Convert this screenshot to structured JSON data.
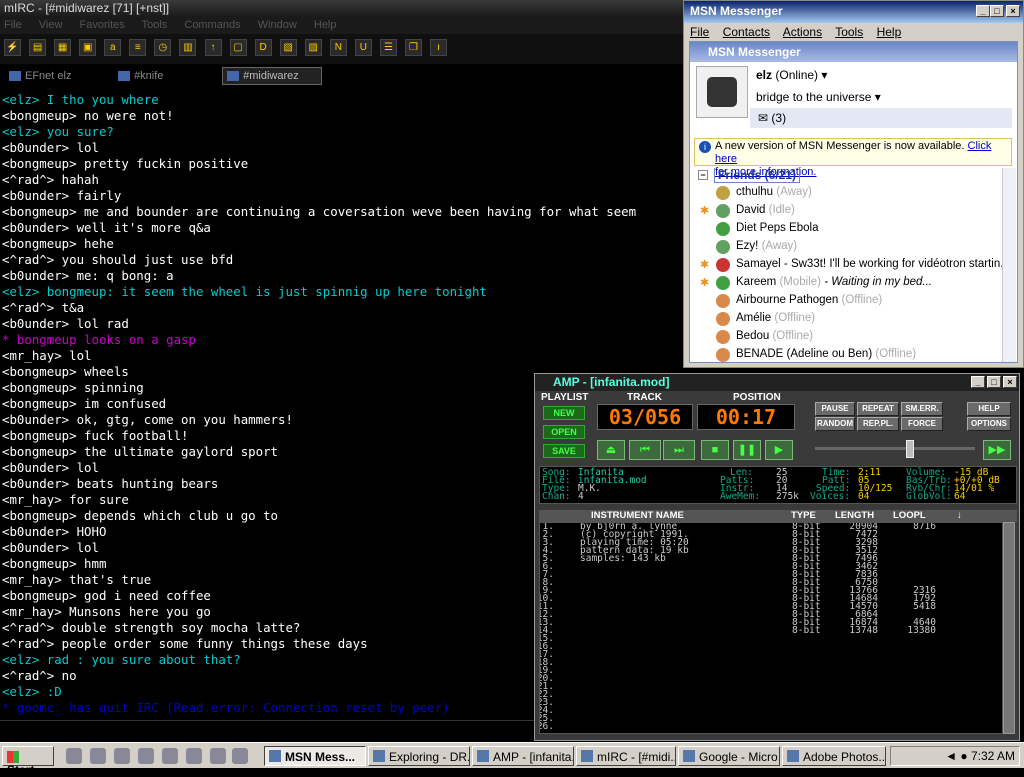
{
  "mirc": {
    "title": "mIRC - [#midiwarez [71] [+nst]]",
    "menu": [
      "File",
      "View",
      "Favorites",
      "Tools",
      "Commands",
      "Window",
      "Help"
    ],
    "tabs": [
      {
        "label": "EFnet elz",
        "active": false
      },
      {
        "label": "#knife",
        "active": false
      },
      {
        "label": "#midiwarez",
        "active": true
      }
    ],
    "colors": {
      "nick_self": "#00cccc",
      "action": "#cc00cc",
      "quit": "#0000cc",
      "default": "#ffffff"
    },
    "lines": [
      {
        "text": "<elz> I tho you where",
        "kind": "self"
      },
      {
        "text": "<bongmeup> no were not!",
        "kind": "normal"
      },
      {
        "text": "<elz> you sure?",
        "kind": "self"
      },
      {
        "text": "<b0under> lol",
        "kind": "normal"
      },
      {
        "text": "<bongmeup> pretty fuckin positive",
        "kind": "normal"
      },
      {
        "text": "<^rad^> hahah",
        "kind": "normal"
      },
      {
        "text": "<b0under> fairly",
        "kind": "normal"
      },
      {
        "text": "<bongmeup> me and bounder are continuing a coversation weve been having for what seem",
        "kind": "normal"
      },
      {
        "text": "<b0under> well it's more q&a",
        "kind": "normal"
      },
      {
        "text": "<bongmeup> hehe",
        "kind": "normal"
      },
      {
        "text": "<^rad^> you should just use bfd",
        "kind": "normal"
      },
      {
        "text": "<b0under> me: q bong: a",
        "kind": "normal"
      },
      {
        "text": "<elz> bongmeup: it seem the wheel is just spinnig up here tonight",
        "kind": "self"
      },
      {
        "text": "<^rad^> t&a",
        "kind": "normal"
      },
      {
        "text": "<b0under> lol rad",
        "kind": "normal"
      },
      {
        "text": "* bongmeup looks on a gasp",
        "kind": "action"
      },
      {
        "text": "<mr_hay> lol",
        "kind": "normal"
      },
      {
        "text": "<bongmeup> wheels",
        "kind": "normal"
      },
      {
        "text": "<bongmeup> spinning",
        "kind": "normal"
      },
      {
        "text": "<bongmeup> im confused",
        "kind": "normal"
      },
      {
        "text": "<b0under> ok, gtg, come on you hammers!",
        "kind": "normal"
      },
      {
        "text": "<bongmeup> fuck football!",
        "kind": "normal"
      },
      {
        "text": "<bongmeup> the ultimate gaylord sport",
        "kind": "normal"
      },
      {
        "text": "<b0under> lol",
        "kind": "normal"
      },
      {
        "text": "<b0under> beats hunting bears",
        "kind": "normal"
      },
      {
        "text": "<mr_hay> for sure",
        "kind": "normal"
      },
      {
        "text": "<bongmeup> depends which club u go to",
        "kind": "normal"
      },
      {
        "text": "<b0under> HOHO",
        "kind": "normal"
      },
      {
        "text": "<b0under> lol",
        "kind": "normal"
      },
      {
        "text": "<bongmeup> hmm",
        "kind": "normal"
      },
      {
        "text": "<mr_hay> that's true",
        "kind": "normal"
      },
      {
        "text": "<bongmeup> god i need coffee",
        "kind": "normal"
      },
      {
        "text": "<mr_hay> Munsons here you go",
        "kind": "normal"
      },
      {
        "text": "<^rad^> double strength soy mocha latte?",
        "kind": "normal"
      },
      {
        "text": "<^rad^> people order some funny things these days",
        "kind": "normal"
      },
      {
        "text": "<elz> rad : you sure about that?",
        "kind": "self"
      },
      {
        "text": "<^rad^> no",
        "kind": "normal"
      },
      {
        "text": "<elz> :D",
        "kind": "self"
      },
      {
        "text": "* goomc_ has quit IRC (Read error: Connection reset by peer)",
        "kind": "quit"
      }
    ]
  },
  "msn": {
    "title": "MSN Messenger",
    "menu": [
      "File",
      "Contacts",
      "Actions",
      "Tools",
      "Help"
    ],
    "panel_title": "MSN Messenger",
    "user": "elz",
    "user_status": "(Online)",
    "tagline": "bridge to the universe",
    "mail_count": "(3)",
    "notice_text": "A new version of MSN Messenger is now available.",
    "notice_link1": "Click here",
    "notice_link2": "for more information.",
    "friends_header": "Friends (6/21)",
    "friends": [
      {
        "name": "cthulhu",
        "status": "(Away)",
        "msg": "",
        "star": false,
        "color": "#c0a040"
      },
      {
        "name": "David",
        "status": "(Idle)",
        "msg": "",
        "star": true,
        "color": "#60a060"
      },
      {
        "name": "Diet Peps Ebola",
        "status": "",
        "msg": "",
        "star": false,
        "color": "#40a040"
      },
      {
        "name": "Ezy!",
        "status": "(Away)",
        "msg": "",
        "star": false,
        "color": "#60a060"
      },
      {
        "name": "Samayel - Sw33t! I'll be working for vidéotron startin...",
        "status": "",
        "msg": "",
        "star": true,
        "color": "#cc3333"
      },
      {
        "name": "Kareem",
        "status": "(Mobile)",
        "msg": "- Waiting in my bed...",
        "star": true,
        "color": "#40a040"
      },
      {
        "name": "Airbourne Pathogen",
        "status": "(Offline)",
        "msg": "",
        "star": false,
        "color": "#d98a4a"
      },
      {
        "name": "Amélie",
        "status": "(Offline)",
        "msg": "",
        "star": false,
        "color": "#d98a4a"
      },
      {
        "name": "Bedou",
        "status": "(Offline)",
        "msg": "",
        "star": false,
        "color": "#d98a4a"
      },
      {
        "name": "BENADE (Adeline ou Ben)",
        "status": "(Offline)",
        "msg": "",
        "star": false,
        "color": "#d98a4a"
      }
    ]
  },
  "amp": {
    "title": "AMP - [infanita.mod]",
    "labels": {
      "playlist": "PLAYLIST",
      "track": "TRACK",
      "position": "POSITION"
    },
    "playlist_buttons": [
      "NEW",
      "OPEN",
      "SAVE"
    ],
    "track_display": "03/056",
    "position_display": "00:17",
    "mode_buttons": [
      "PAUSE",
      "REPEAT",
      "SM.ERR.",
      "RANDOM",
      "REP.PL.",
      "FORCE"
    ],
    "side_buttons": [
      "HELP",
      "OPTIONS"
    ],
    "transport_icons": [
      "eject-icon",
      "prev-icon",
      "next-icon",
      "stop-icon",
      "pause-icon",
      "play-icon"
    ],
    "volume_level": 0.6,
    "info": {
      "song_label": "Song:",
      "song": "Infanita",
      "file_label": "File:",
      "file": "infanita.mod",
      "type_label": "Type:",
      "type": "M.K.",
      "chan_label": "Chan:",
      "chan": "4",
      "len_label": "Len:",
      "len": "25",
      "patts_label": "Patts:",
      "patts": "20",
      "instr_label": "Instr:",
      "instr": "14",
      "awemem_label": "AweMem:",
      "awemem": "275k",
      "time_label": "Time:",
      "time": "2:11",
      "patt_label": "Patt:",
      "patt": "05",
      "speed_label": "Speed:",
      "speed": "10/125",
      "voices_label": "Voices:",
      "voices": "04",
      "volume_label": "Volume:",
      "volume": "-15 dB",
      "bastrb_label": "Bas/Trb:",
      "bastrb": "+0/+0 dB",
      "rvbchr_label": "Rvb/Chr:",
      "rvbchr": "14/01 %",
      "globvol_label": "GlobVol:",
      "globvol": "64"
    },
    "inst_headers": [
      "INSTRUMENT NAME",
      "TYPE",
      "LENGTH",
      "LOOPL",
      "↓"
    ],
    "instruments": [
      {
        "n": "1.",
        "name": "by bj0rn a. lynne",
        "type": "8-bit",
        "length": "20904",
        "loopl": "8716"
      },
      {
        "n": "2.",
        "name": "(c) copyright 1991.",
        "type": "8-bit",
        "length": "7472",
        "loopl": ""
      },
      {
        "n": "3.",
        "name": "playing time: 05:20",
        "type": "8-bit",
        "length": "3298",
        "loopl": ""
      },
      {
        "n": "4.",
        "name": "pattern data: 19 kb",
        "type": "8-bit",
        "length": "3512",
        "loopl": ""
      },
      {
        "n": "5.",
        "name": "samples: 143 kb",
        "type": "8-bit",
        "length": "7496",
        "loopl": ""
      },
      {
        "n": "6.",
        "name": "",
        "type": "8-bit",
        "length": "3462",
        "loopl": ""
      },
      {
        "n": "7.",
        "name": "",
        "type": "8-bit",
        "length": "7836",
        "loopl": ""
      },
      {
        "n": "8.",
        "name": "",
        "type": "8-bit",
        "length": "6750",
        "loopl": ""
      },
      {
        "n": "9.",
        "name": "",
        "type": "8-bit",
        "length": "13766",
        "loopl": "2316"
      },
      {
        "n": "10.",
        "name": "",
        "type": "8-bit",
        "length": "14684",
        "loopl": "1792"
      },
      {
        "n": "11.",
        "name": "",
        "type": "8-bit",
        "length": "14570",
        "loopl": "5418"
      },
      {
        "n": "12.",
        "name": "",
        "type": "8-bit",
        "length": "6864",
        "loopl": ""
      },
      {
        "n": "13.",
        "name": "",
        "type": "8-bit",
        "length": "16874",
        "loopl": "4640"
      },
      {
        "n": "14.",
        "name": "",
        "type": "8-bit",
        "length": "13748",
        "loopl": "13380"
      },
      {
        "n": "15.",
        "name": "",
        "type": "",
        "length": "",
        "loopl": ""
      },
      {
        "n": "16.",
        "name": "",
        "type": "",
        "length": "",
        "loopl": ""
      },
      {
        "n": "17.",
        "name": "",
        "type": "",
        "length": "",
        "loopl": ""
      },
      {
        "n": "18.",
        "name": "",
        "type": "",
        "length": "",
        "loopl": ""
      },
      {
        "n": "19.",
        "name": "",
        "type": "",
        "length": "",
        "loopl": ""
      },
      {
        "n": "20.",
        "name": "",
        "type": "",
        "length": "",
        "loopl": ""
      },
      {
        "n": "21.",
        "name": "",
        "type": "",
        "length": "",
        "loopl": ""
      },
      {
        "n": "22.",
        "name": "",
        "type": "",
        "length": "",
        "loopl": ""
      },
      {
        "n": "23.",
        "name": "",
        "type": "",
        "length": "",
        "loopl": ""
      },
      {
        "n": "24.",
        "name": "",
        "type": "",
        "length": "",
        "loopl": ""
      },
      {
        "n": "25.",
        "name": "",
        "type": "",
        "length": "",
        "loopl": ""
      },
      {
        "n": "26.",
        "name": "",
        "type": "",
        "length": "",
        "loopl": ""
      }
    ]
  },
  "taskbar": {
    "start": "Start",
    "tasks": [
      {
        "label": "MSN Mess...",
        "active": true
      },
      {
        "label": "Exploring - DR...",
        "active": false
      },
      {
        "label": "AMP - [infanita...",
        "active": false
      },
      {
        "label": "mIRC - [#midi...",
        "active": false
      },
      {
        "label": "Google - Micro...",
        "active": false
      },
      {
        "label": "Adobe Photos...",
        "active": false
      }
    ],
    "clock": "7:32 AM"
  }
}
